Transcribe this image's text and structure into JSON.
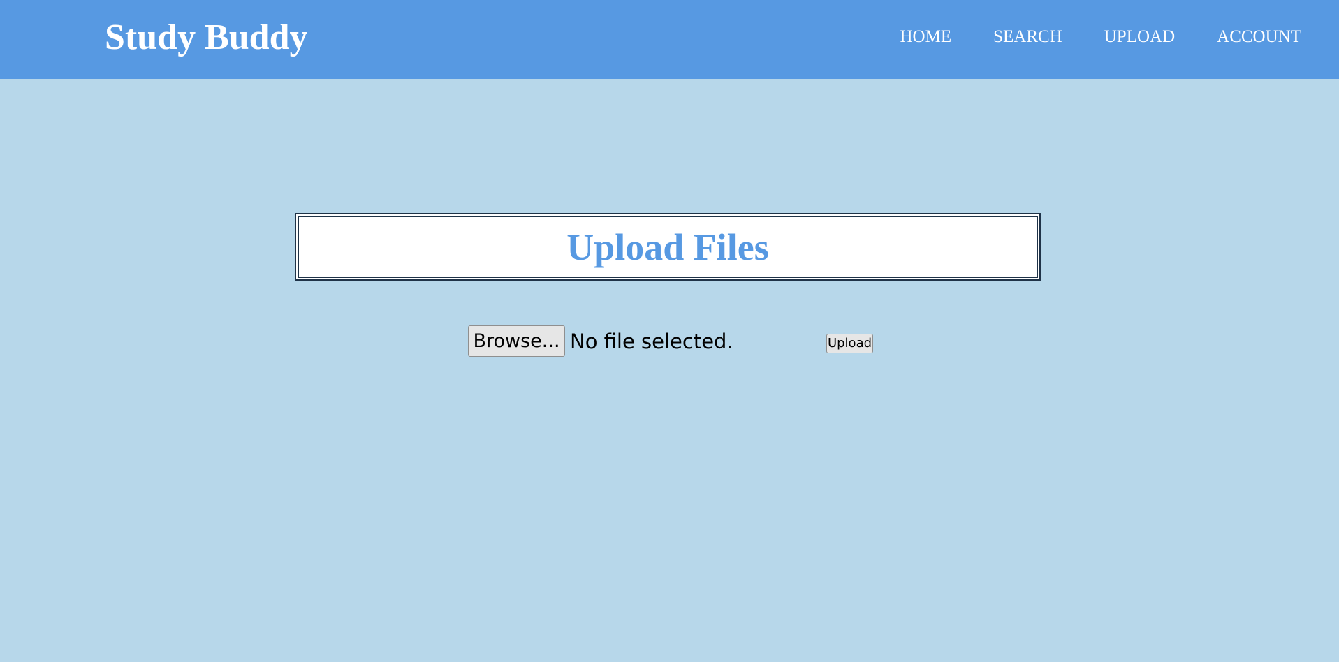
{
  "header": {
    "brand": "Study Buddy",
    "nav": [
      {
        "label": "HOME"
      },
      {
        "label": "SEARCH"
      },
      {
        "label": "UPLOAD"
      },
      {
        "label": "ACCOUNT"
      }
    ]
  },
  "main": {
    "title": "Upload Files",
    "file_input": {
      "browse_label": "Browse...",
      "status": "No file selected."
    },
    "upload_label": "Upload"
  },
  "colors": {
    "header_bg": "#5799e2",
    "page_bg": "#b7d7ea",
    "title_color": "#5799e2",
    "title_border": "#1f3348"
  }
}
